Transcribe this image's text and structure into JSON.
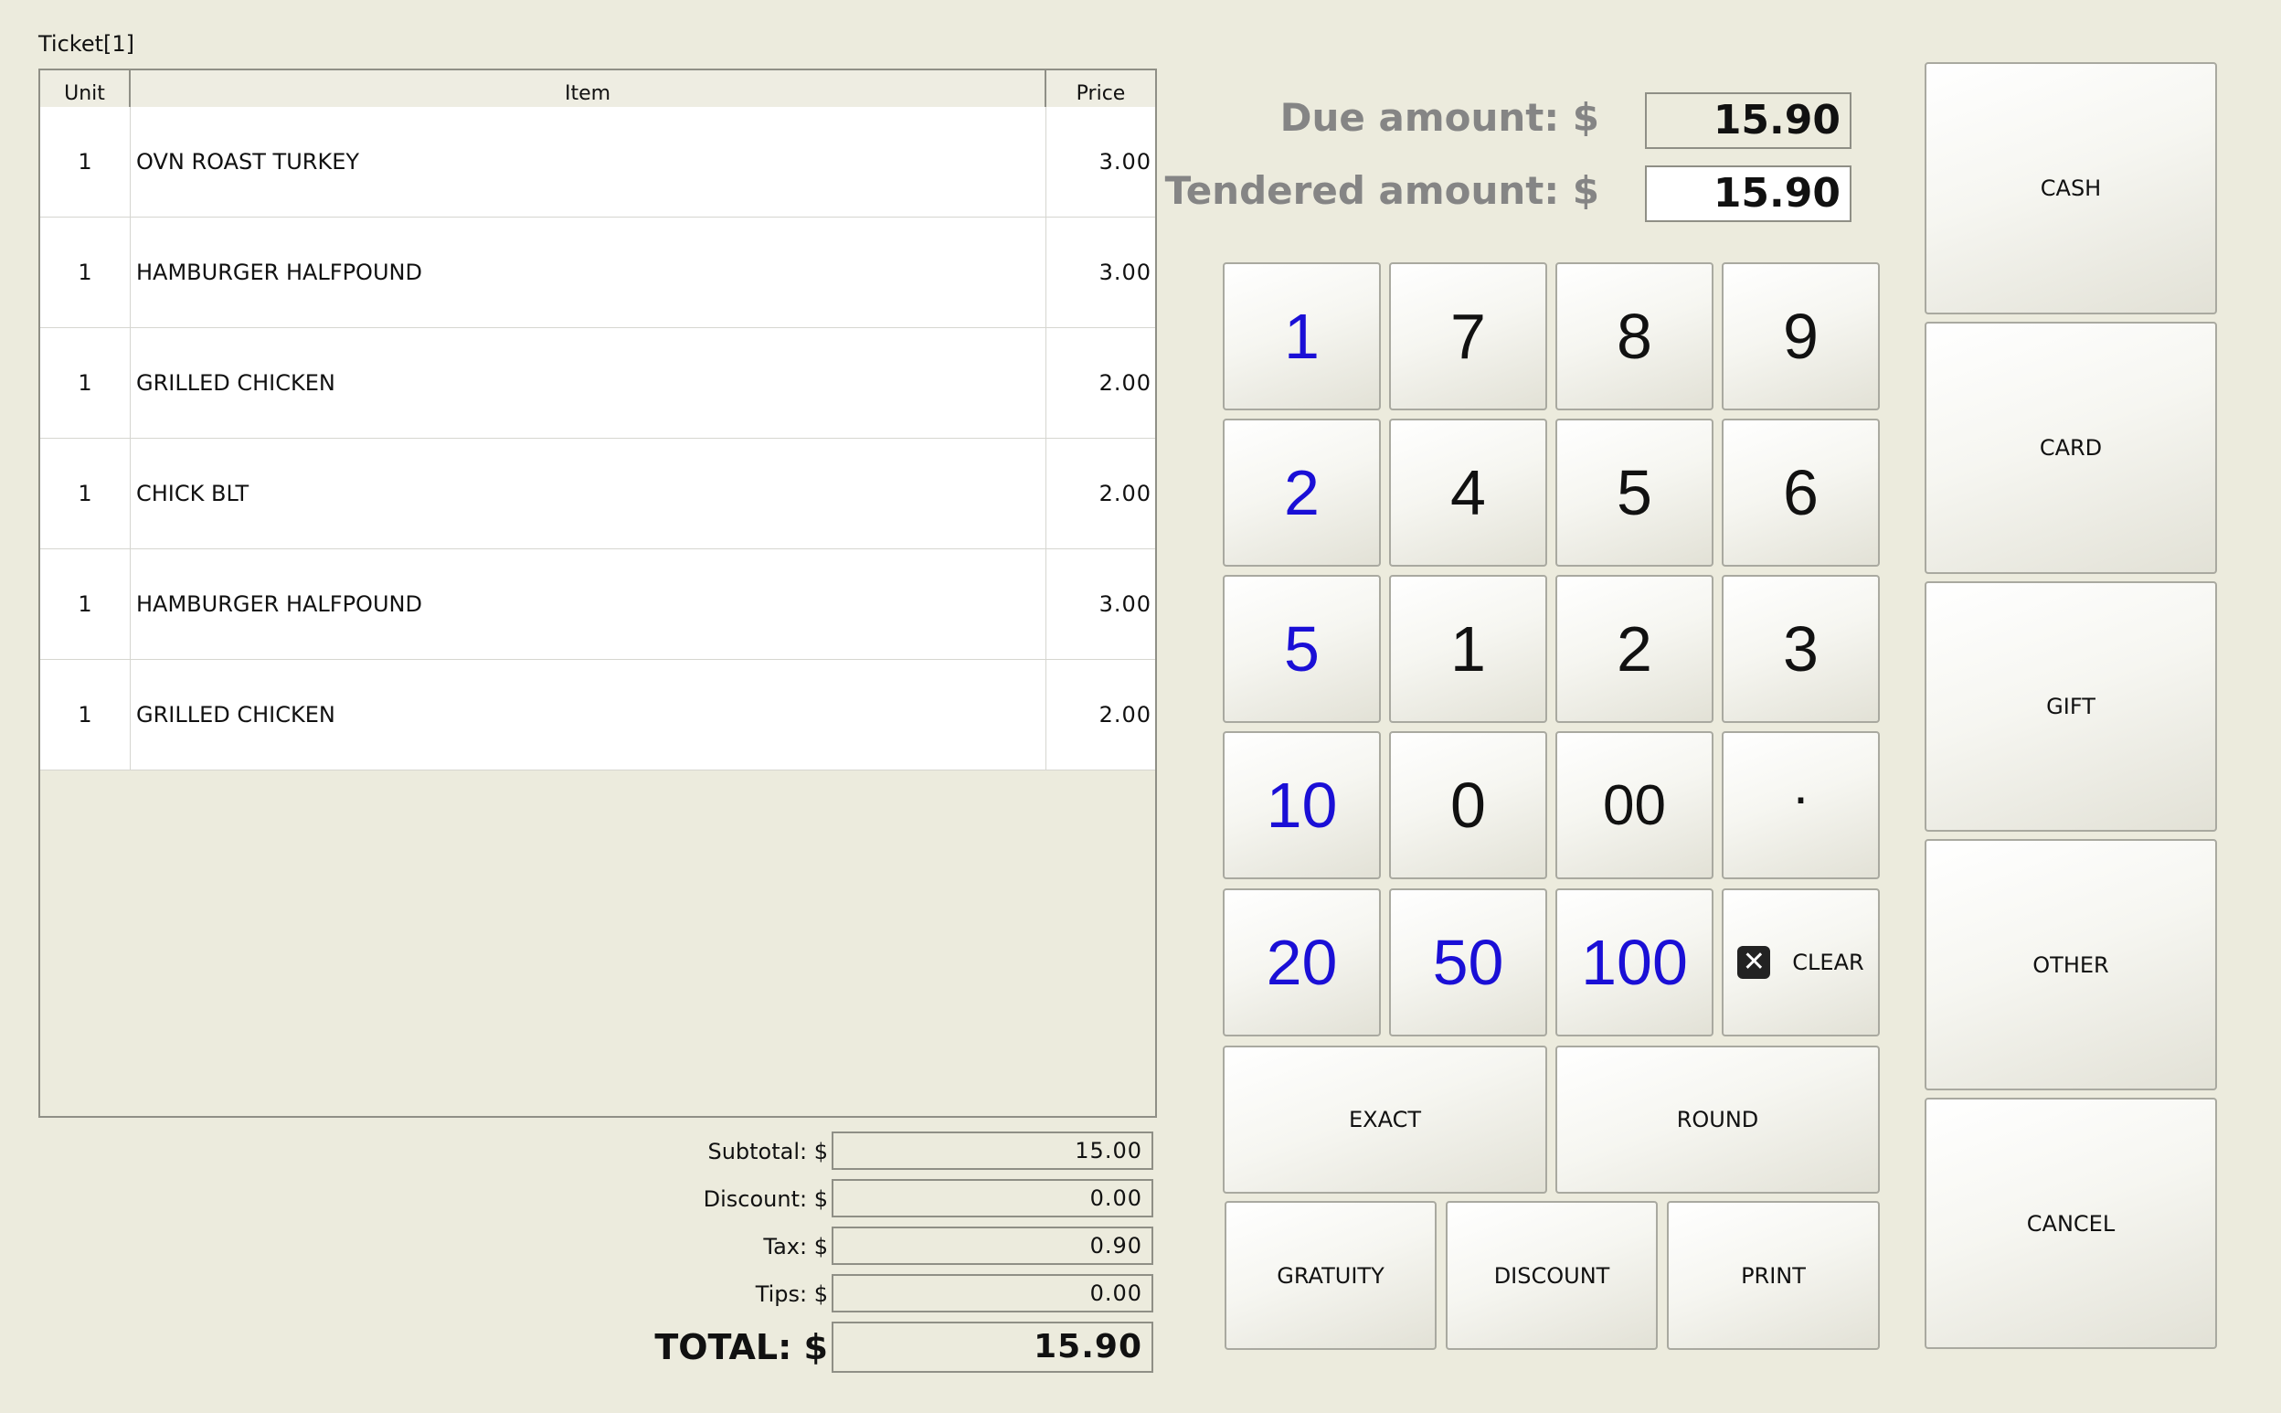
{
  "ticket": {
    "label": "Ticket[1]",
    "headers": {
      "unit": "Unit",
      "item": "Item",
      "price": "Price"
    },
    "rows": [
      {
        "unit": "1",
        "item": "OVN ROAST TURKEY",
        "price": "3.00"
      },
      {
        "unit": "1",
        "item": "HAMBURGER HALFPOUND",
        "price": "3.00"
      },
      {
        "unit": "1",
        "item": "GRILLED CHICKEN",
        "price": "2.00"
      },
      {
        "unit": "1",
        "item": "CHICK BLT",
        "price": "2.00"
      },
      {
        "unit": "1",
        "item": "HAMBURGER HALFPOUND",
        "price": "3.00"
      },
      {
        "unit": "1",
        "item": "GRILLED CHICKEN",
        "price": "2.00"
      }
    ]
  },
  "totals": {
    "subtotal_label": "Subtotal: $",
    "subtotal": "15.00",
    "discount_label": "Discount: $",
    "discount": "0.00",
    "tax_label": "Tax: $",
    "tax": "0.90",
    "tips_label": "Tips: $",
    "tips": "0.00",
    "total_label": "TOTAL: $",
    "total": "15.90"
  },
  "amounts": {
    "due_label": "Due amount:  $",
    "due": "15.90",
    "tendered_label": "Tendered amount:  $",
    "tendered": "15.90"
  },
  "keypad": {
    "quick": [
      "1",
      "2",
      "5",
      "10",
      "20",
      "50",
      "100"
    ],
    "digits": [
      "7",
      "8",
      "9",
      "4",
      "5",
      "6",
      "1",
      "2",
      "3",
      "0",
      "00",
      "·"
    ],
    "clear": "CLEAR",
    "exact": "EXACT",
    "round": "ROUND",
    "gratuity": "GRATUITY",
    "discount": "DISCOUNT",
    "print": "PRINT"
  },
  "payment": {
    "cash": "CASH",
    "card": "CARD",
    "gift": "GIFT",
    "other": "OTHER",
    "cancel": "CANCEL"
  },
  "colors": {
    "background": "#ecebdd",
    "quick_key_text": "#1a0fd6",
    "amount_label": "#858585"
  },
  "icons": {
    "clear": "clear-x-icon"
  }
}
